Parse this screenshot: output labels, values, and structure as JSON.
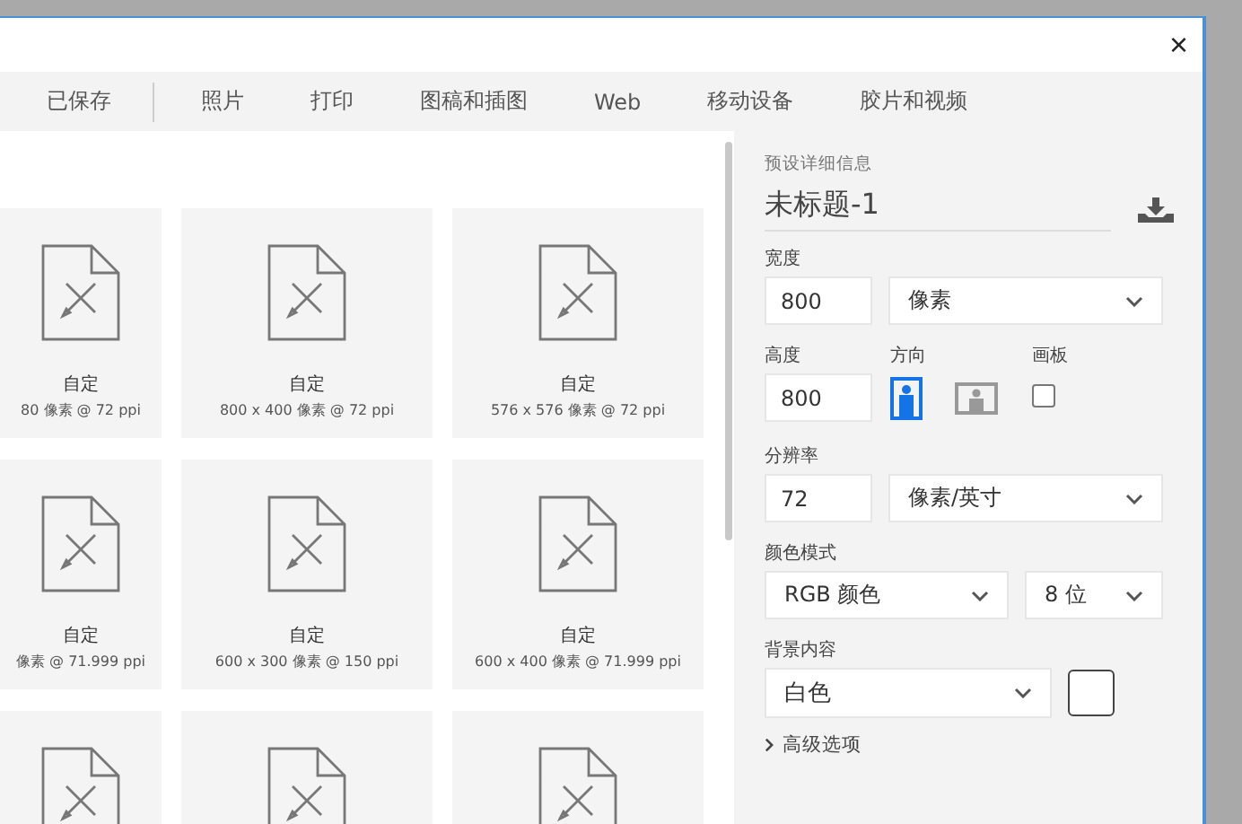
{
  "window": {
    "close": "×"
  },
  "tabs": [
    {
      "label": "已保存"
    },
    {
      "label": "照片"
    },
    {
      "label": "打印"
    },
    {
      "label": "图稿和插图"
    },
    {
      "label": "Web"
    },
    {
      "label": "移动设备"
    },
    {
      "label": "胶片和视频"
    }
  ],
  "presets": [
    {
      "kind": "captioned",
      "title": "自定",
      "size": "80 像素 @ 72 ppi"
    },
    {
      "kind": "captioned",
      "title": "自定",
      "size": "800 x 400 像素 @ 72 ppi"
    },
    {
      "kind": "captioned",
      "title": "自定",
      "size": "576 x 576 像素 @ 72 ppi"
    },
    {
      "kind": "captioned",
      "title": "自定",
      "size": "像素 @ 71.999 ppi"
    },
    {
      "kind": "captioned",
      "title": "自定",
      "size": "600 x 300 像素 @ 150 ppi"
    },
    {
      "kind": "captioned",
      "title": "自定",
      "size": "600 x 400 像素 @ 71.999 ppi"
    },
    {
      "kind": "cut_off"
    },
    {
      "kind": "cut_off"
    },
    {
      "kind": "cut_off"
    }
  ],
  "details": {
    "heading": "预设详细信息",
    "name": "未标题-1",
    "width": {
      "label": "宽度",
      "value": "800",
      "unit": "像素"
    },
    "height": {
      "label": "高度",
      "value": "800"
    },
    "orientation": {
      "label": "方向",
      "options": [
        {
          "kind": "portrait",
          "selected": true
        },
        {
          "kind": "landscape",
          "selected": false
        }
      ]
    },
    "artboard": {
      "label": "画板",
      "checked": false
    },
    "resolution": {
      "label": "分辨率",
      "value": "72",
      "unit": "像素/英寸"
    },
    "color_mode": {
      "label": "颜色模式",
      "mode": "RGB 颜色",
      "depth": "8 位"
    },
    "background": {
      "label": "背景内容",
      "value": "白色",
      "color": "#ffffff"
    },
    "advanced": {
      "label": "高级选项",
      "expanded": false
    }
  }
}
